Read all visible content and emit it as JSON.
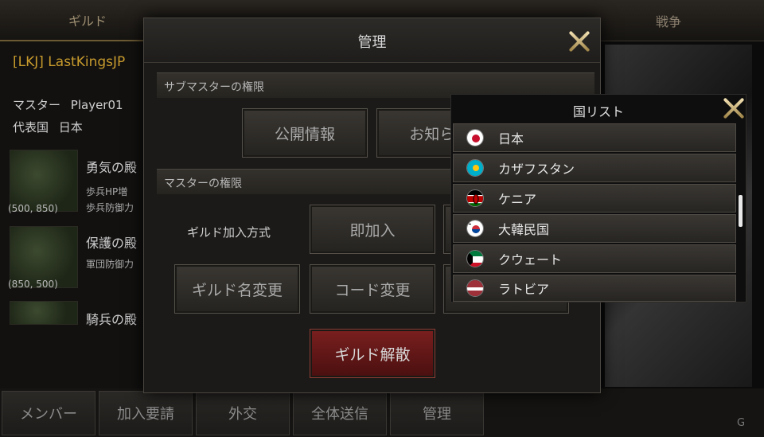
{
  "background": {
    "top_tabs": {
      "guild": "ギルド",
      "war": "戦争"
    },
    "guild": {
      "name": "[LKJ] LastKingsJP",
      "master_label": "マスター",
      "master_name": "Player01",
      "country_label": "代表国",
      "country_value": "日本"
    },
    "buildings": [
      {
        "name": "勇気の殿",
        "line1": "歩兵HP増",
        "line2": "歩兵防御力",
        "coord": "(500, 850)"
      },
      {
        "name": "保護の殿",
        "line1": "軍団防御力",
        "coord": "(850, 500)"
      },
      {
        "name": "騎兵の殿"
      }
    ],
    "bottom_tabs": [
      "メンバー",
      "加入要請",
      "外交",
      "全体送信",
      "管理"
    ],
    "logo_text": "G"
  },
  "dialog": {
    "title": "管理",
    "submaster_section": "サブマスターの権限",
    "submaster_buttons": [
      "公開情報",
      "お知らせ"
    ],
    "master_section": "マスターの権限",
    "join_method_label": "ギルド加入方式",
    "join_method_value": "即加入",
    "master_buttons": [
      "ギルド名変更",
      "コード変更"
    ],
    "disband_button": "ギルド解散"
  },
  "country_list": {
    "title": "国リスト",
    "items": [
      {
        "name": "日本",
        "flag": "flag-japan-icon"
      },
      {
        "name": "カザフスタン",
        "flag": "flag-kazakhstan-icon"
      },
      {
        "name": "ケニア",
        "flag": "flag-kenya-icon"
      },
      {
        "name": "大韓民国",
        "flag": "flag-south-korea-icon"
      },
      {
        "name": "クウェート",
        "flag": "flag-kuwait-icon"
      },
      {
        "name": "ラトビア",
        "flag": "flag-latvia-icon"
      }
    ]
  }
}
